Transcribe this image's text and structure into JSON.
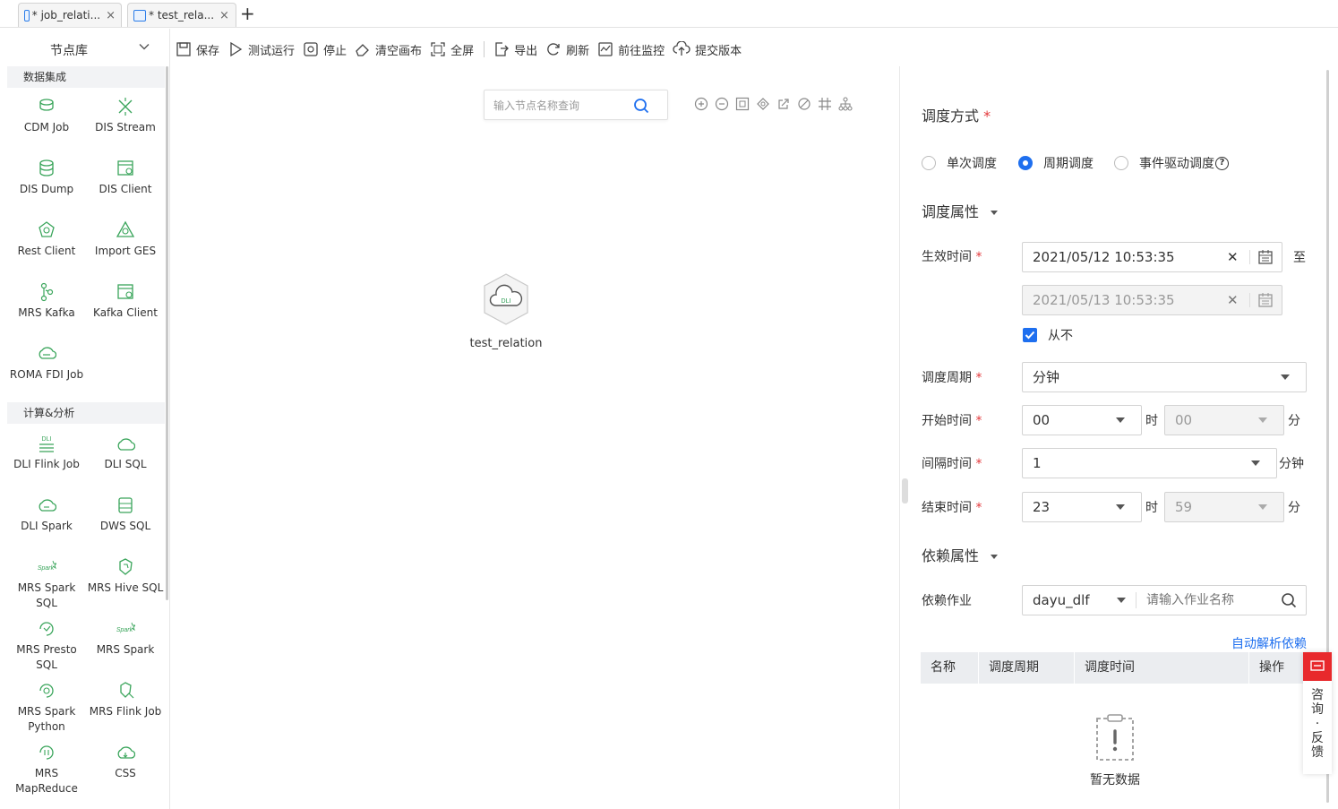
{
  "tabs": [
    {
      "label": "* job_relati...",
      "icon": "job-icon"
    },
    {
      "label": "* test_rela...",
      "icon": "dli-icon"
    }
  ],
  "tab_close": "×",
  "tab_add": "+",
  "node_library": {
    "title": "节点库",
    "sections": [
      {
        "title": "数据集成",
        "items": [
          {
            "label": "CDM Job",
            "icon": "cdm-icon"
          },
          {
            "label": "DIS Stream",
            "icon": "dis-stream-icon"
          },
          {
            "label": "DIS Dump",
            "icon": "dis-dump-icon"
          },
          {
            "label": "DIS Client",
            "icon": "dis-client-icon"
          },
          {
            "label": "Rest Client",
            "icon": "rest-client-icon"
          },
          {
            "label": "Import GES",
            "icon": "import-ges-icon"
          },
          {
            "label": "MRS Kafka",
            "icon": "mrs-kafka-icon"
          },
          {
            "label": "Kafka Client",
            "icon": "kafka-client-icon"
          },
          {
            "label": "ROMA FDI Job",
            "icon": "roma-fdi-icon"
          }
        ]
      },
      {
        "title": "计算&分析",
        "items": [
          {
            "label": "DLI Flink Job",
            "icon": "dli-flink-icon"
          },
          {
            "label": "DLI SQL",
            "icon": "dli-sql-icon"
          },
          {
            "label": "DLI Spark",
            "icon": "dli-spark-icon"
          },
          {
            "label": "DWS SQL",
            "icon": "dws-sql-icon"
          },
          {
            "label": "MRS Spark SQL",
            "icon": "mrs-spark-sql-icon"
          },
          {
            "label": "MRS Hive SQL",
            "icon": "mrs-hive-sql-icon"
          },
          {
            "label": "MRS Presto SQL",
            "icon": "mrs-presto-icon"
          },
          {
            "label": "MRS Spark",
            "icon": "mrs-spark-icon"
          },
          {
            "label": "MRS Spark Python",
            "icon": "mrs-spark-python-icon"
          },
          {
            "label": "MRS Flink Job",
            "icon": "mrs-flink-icon"
          },
          {
            "label": "MRS MapReduce",
            "icon": "mrs-mapreduce-icon"
          },
          {
            "label": "CSS",
            "icon": "css-icon"
          }
        ]
      }
    ]
  },
  "toolbar": {
    "save": "保存",
    "test_run": "测试运行",
    "stop": "停止",
    "clear_canvas": "清空画布",
    "fullscreen": "全屏",
    "export": "导出",
    "refresh": "刷新",
    "goto_monitor": "前往监控",
    "submit_version": "提交版本"
  },
  "canvas": {
    "search_placeholder": "输入节点名称查询",
    "node": {
      "label": "test_relation",
      "badge": "DLI"
    }
  },
  "schedule": {
    "mode_title": "调度方式",
    "modes": [
      "单次调度",
      "周期调度",
      "事件驱动调度"
    ],
    "selected_mode": "周期调度",
    "props_title": "调度属性",
    "effective_time_label": "生效时间",
    "effective_start": "2021/05/12 10:53:35",
    "effective_end": "2021/05/13 10:53:35",
    "to": "至",
    "never_label": "从不",
    "never_checked": true,
    "period_label": "调度周期",
    "period_value": "分钟",
    "start_time_label": "开始时间",
    "start_hour": "00",
    "start_minute": "00",
    "hour_unit": "时",
    "minute_unit": "分",
    "interval_label": "间隔时间",
    "interval_value": "1",
    "interval_unit": "分钟",
    "end_time_label": "结束时间",
    "end_hour": "23",
    "end_minute": "59",
    "clear_glyph": "✕",
    "required_mark": "*",
    "help_glyph": "?"
  },
  "dependency": {
    "title": "依赖属性",
    "job_label": "依赖作业",
    "project_value": "dayu_dlf",
    "job_placeholder": "请输入作业名称",
    "auto_parse_link": "自动解析依赖",
    "columns": [
      "名称",
      "调度周期",
      "调度时间",
      "操作"
    ],
    "empty_text": "暂无数据"
  },
  "feedback": {
    "label": "咨询·反馈"
  },
  "colors": {
    "primary": "#1e6fef",
    "required": "#e3383b",
    "icon_green": "#3aa55b",
    "feedback_red": "#e8292c"
  }
}
